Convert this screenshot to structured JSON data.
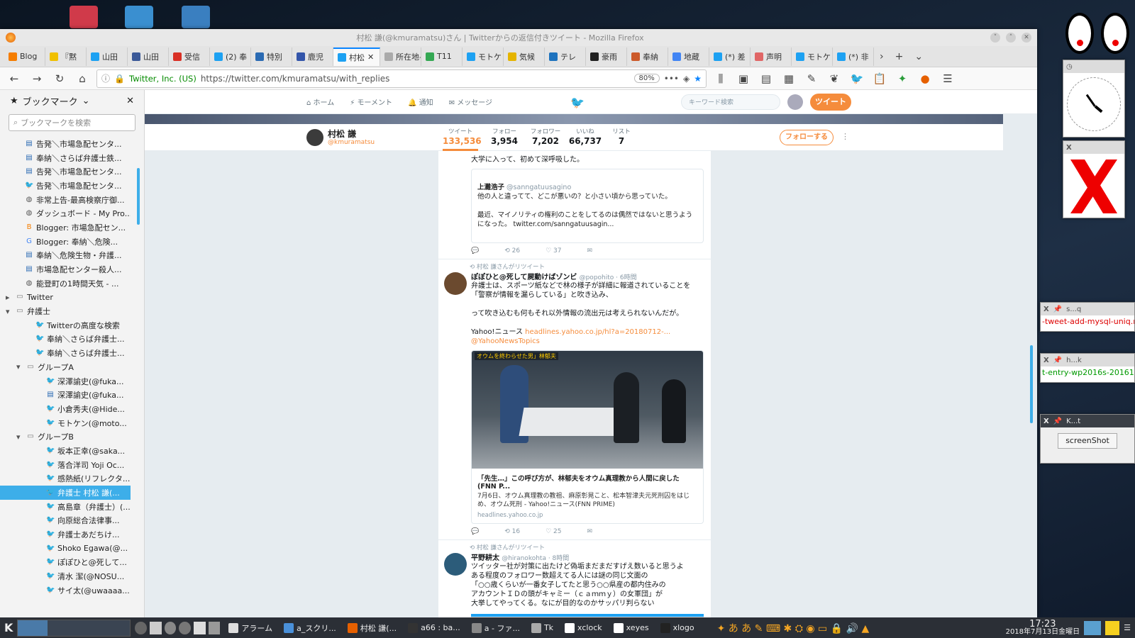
{
  "window": {
    "title": "村松 謙(@kmuramatsu)さん | Twitterからの返信付きツイート - Mozilla Firefox"
  },
  "tabs": [
    {
      "label": "Blog",
      "color": "#f57d00"
    },
    {
      "label": "『黙",
      "color": "#f0c000"
    },
    {
      "label": "山田",
      "color": "#1da1f2"
    },
    {
      "label": "山田",
      "color": "#3b5998"
    },
    {
      "label": "受信",
      "color": "#d93025"
    },
    {
      "label": "(2) 奉",
      "color": "#1da1f2"
    },
    {
      "label": "特別",
      "color": "#2a6ab3"
    },
    {
      "label": "鹿児",
      "color": "#3355aa"
    },
    {
      "label": "村松",
      "color": "#1da1f2",
      "active": true
    },
    {
      "label": "所在地-",
      "color": "#aaaaaa"
    },
    {
      "label": "T11",
      "color": "#34a853"
    },
    {
      "label": "モトケ",
      "color": "#1da1f2"
    },
    {
      "label": "気候",
      "color": "#e5b400"
    },
    {
      "label": "テレ",
      "color": "#1e73be"
    },
    {
      "label": "豪雨",
      "color": "#222222"
    },
    {
      "label": "奉納",
      "color": "#cc5a2a"
    },
    {
      "label": "地蔵",
      "color": "#4285f4"
    },
    {
      "label": "(*) 差",
      "color": "#1da1f2"
    },
    {
      "label": "声明",
      "color": "#e06666"
    },
    {
      "label": "モトケ",
      "color": "#1da1f2"
    },
    {
      "label": "(*) 非",
      "color": "#1da1f2"
    }
  ],
  "urlbar": {
    "identity": "Twitter, Inc. (US)",
    "url": "https://twitter.com/kmuramatsu/with_replies",
    "zoom": "80%"
  },
  "sidebar": {
    "title": "ブックマーク",
    "search_placeholder": "ブックマークを検索",
    "items": [
      {
        "label": "告発＼市場急配センタ...",
        "indent": 1,
        "icon": "site"
      },
      {
        "label": "奉納＼さらば弁護士鉄...",
        "indent": 1,
        "icon": "site"
      },
      {
        "label": "告発＼市場急配センタ...",
        "indent": 1,
        "icon": "site"
      },
      {
        "label": "告発＼市場急配センタ...",
        "indent": 1,
        "icon": "twitter"
      },
      {
        "label": "非常上告-最高検察庁御...",
        "indent": 1,
        "icon": "globe"
      },
      {
        "label": "ダッシュボード - My Pro...",
        "indent": 1,
        "icon": "globe"
      },
      {
        "label": "Blogger: 市場急配セン...",
        "indent": 1,
        "icon": "blogger"
      },
      {
        "label": "Blogger: 奉納＼危険...",
        "indent": 1,
        "icon": "google"
      },
      {
        "label": "奉納＼危険生物・弁護...",
        "indent": 1,
        "icon": "site"
      },
      {
        "label": "市場急配センター殺人...",
        "indent": 1,
        "icon": "site"
      },
      {
        "label": "能登町の1時間天気 - ...",
        "indent": 1,
        "icon": "globe"
      },
      {
        "label": "Twitter",
        "indent": 0,
        "icon": "folder",
        "arrow": "▸"
      },
      {
        "label": "弁護士",
        "indent": 0,
        "icon": "folder",
        "arrow": "▾"
      },
      {
        "label": "Twitterの高度な検索",
        "indent": 2,
        "icon": "twitter"
      },
      {
        "label": "奉納＼さらば弁護士...",
        "indent": 2,
        "icon": "twitter"
      },
      {
        "label": "奉納＼さらば弁護士...",
        "indent": 2,
        "icon": "twitter"
      },
      {
        "label": "グループA",
        "indent": 1,
        "icon": "folder",
        "arrow": "▾"
      },
      {
        "label": "深澤諭史(@fuka...",
        "indent": 3,
        "icon": "twitter"
      },
      {
        "label": "深澤諭史(@fuka...",
        "indent": 3,
        "icon": "site"
      },
      {
        "label": "小倉秀夫(@Hide...",
        "indent": 3,
        "icon": "twitter"
      },
      {
        "label": "モトケン(@moto...",
        "indent": 3,
        "icon": "twitter"
      },
      {
        "label": "グループB",
        "indent": 1,
        "icon": "folder",
        "arrow": "▾"
      },
      {
        "label": "坂本正幸(@saka...",
        "indent": 3,
        "icon": "twitter"
      },
      {
        "label": "落合洋司 Yoji Oc...",
        "indent": 3,
        "icon": "twitter"
      },
      {
        "label": "感熱紙(リフレクタ...",
        "indent": 3,
        "icon": "twitter"
      },
      {
        "label": "弁護士 村松 謙(...",
        "indent": 3,
        "icon": "twitter",
        "selected": true
      },
      {
        "label": "高島章（弁護士）(...",
        "indent": 3,
        "icon": "twitter"
      },
      {
        "label": "向原総合法律事...",
        "indent": 3,
        "icon": "twitter"
      },
      {
        "label": "弁護士あだちけ...",
        "indent": 3,
        "icon": "twitter"
      },
      {
        "label": "Shoko Egawa(@...",
        "indent": 3,
        "icon": "twitter"
      },
      {
        "label": "ぽぽひと@死して...",
        "indent": 3,
        "icon": "twitter"
      },
      {
        "label": "清水 潔(@NOSU...",
        "indent": 3,
        "icon": "twitter"
      },
      {
        "label": "サイ太(@uwaaaa...",
        "indent": 3,
        "icon": "twitter"
      }
    ]
  },
  "twitter_nav": {
    "home": "ホーム",
    "moments": "モーメント",
    "notifications": "通知",
    "messages": "メッセージ",
    "search_placeholder": "キーワード検索",
    "tweet_button": "ツイート"
  },
  "profile": {
    "name": "村松 謙",
    "handle": "@kmuramatsu",
    "follow_button": "フォローする",
    "stats": [
      {
        "label": "ツイート",
        "value": "133,536"
      },
      {
        "label": "フォロー",
        "value": "3,954"
      },
      {
        "label": "フォロワー",
        "value": "7,202"
      },
      {
        "label": "いいね",
        "value": "66,737"
      },
      {
        "label": "リスト",
        "value": "7"
      }
    ]
  },
  "tweets": [
    {
      "top_text": "大学に入って、初めて深呼吸した。",
      "quote_author": "上灘浩子",
      "quote_handle": "@sanngatuusagino",
      "quote_text": "他の人と違ってて、どこが悪いの？と小さい頃から思っていた。\n\n最近、マイノリティの権利のことをしてるのは偶然ではないと思うようになった。 twitter.com/sanngatuusagin...",
      "retweets": "26",
      "likes": "37"
    },
    {
      "rt_label": "村松 謙さんがリツイート",
      "author": "ぽぽひと@死して屍動けばゾンビ",
      "handle": "@popohito · 6時間",
      "text": "弁護士は、スポーツ紙などで林の様子が詳細に報道されていることを「警察が情報を漏らしている」と吹き込み、\n\nって吹き込むも何もそれ以外情報の流出元は考えられないんだが。",
      "yahoo_prefix": "Yahoo!ニュース ",
      "yahoo_link": "headlines.yahoo.co.jp/hl?a=20180712-...",
      "yahoo_handle": " @YahooNewsTopics",
      "card_caption": "オウムを終わらせた男」林郁夫",
      "card_title": "「先生…」この呼び方が、林郁夫をオウム真理教から人間に戻した(FNN P...",
      "card_desc": "7月6日、オウム真理教の教祖、麻原彰晃こと、松本智津夫元死刑囚をはじめ、オウム死刑 - Yahoo!ニュース(FNN PRIME)",
      "card_domain": "headlines.yahoo.co.jp",
      "retweets": "16",
      "likes": "25"
    },
    {
      "rt_label": "村松 謙さんがリツイート",
      "author": "平野耕太",
      "handle": "@hiranokohta · 8時間",
      "text": "ツイッター社が対策に出たけど偽垢まだまだすげえ数いると思うよ\nある程度のフォロワー数超えてる人には謎の同じ文面の\n「○○歳くらいが一番女子してたと思う○○県産の都内住みの\nアカウントＩＤの頭がキャミー（ｃａｍｍｙ）の女軍団」が\n大挙してやってくる。なにが目的なのかサッパリ判らない"
    }
  ],
  "side_windows": [
    {
      "title": "s...q",
      "text": "-tweet-add-mysql-uniq.rl"
    },
    {
      "title": "h...k",
      "text": "t-entry-wp2016s-20161("
    },
    {
      "title": "K...t",
      "button": "screenShot"
    }
  ],
  "taskbar": {
    "items": [
      {
        "label": "アラーム",
        "color": "#ddd"
      },
      {
        "label": "a_スクリ...",
        "color": "#4a90d9"
      },
      {
        "label": "村松 謙(...",
        "color": "#e66000"
      },
      {
        "label": "a66 : ba...",
        "color": "#333"
      },
      {
        "label": "a - ファ...",
        "color": "#888"
      },
      {
        "label": "Tk",
        "color": "#aaa"
      },
      {
        "label": "xclock",
        "color": "#fff"
      },
      {
        "label": "xeyes",
        "color": "#fff"
      },
      {
        "label": "xlogo",
        "color": "#222"
      }
    ],
    "time": "17:23",
    "date": "2018年7月13日金曜日"
  }
}
